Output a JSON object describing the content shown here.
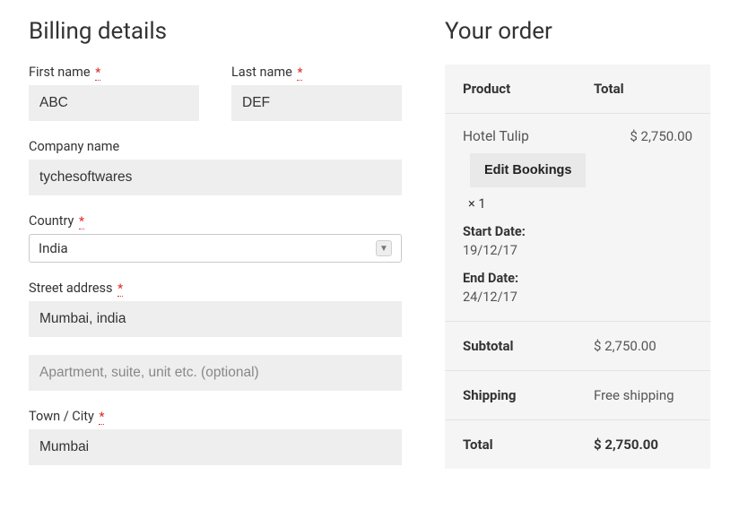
{
  "billing": {
    "heading": "Billing details",
    "first_name_label": "First name",
    "first_name_value": "ABC",
    "last_name_label": "Last name",
    "last_name_value": "DEF",
    "company_label": "Company name",
    "company_value": "tychesoftwares",
    "country_label": "Country",
    "country_value": "India",
    "street_label": "Street address",
    "street_line1_value": "Mumbai, india",
    "street_line2_placeholder": "Apartment, suite, unit etc. (optional)",
    "city_label": "Town / City",
    "city_value": "Mumbai",
    "required_marker": "*"
  },
  "order": {
    "heading": "Your order",
    "col_product": "Product",
    "col_total": "Total",
    "product_name": "Hotel Tulip",
    "product_total": "$ 2,750.00",
    "edit_label": "Edit Bookings",
    "qty": "× 1",
    "start_label": "Start Date:",
    "start_value": "19/12/17",
    "end_label": "End Date:",
    "end_value": "24/12/17",
    "subtotal_label": "Subtotal",
    "subtotal_value": "$ 2,750.00",
    "shipping_label": "Shipping",
    "shipping_value": "Free shipping",
    "total_label": "Total",
    "total_value": "$ 2,750.00"
  }
}
